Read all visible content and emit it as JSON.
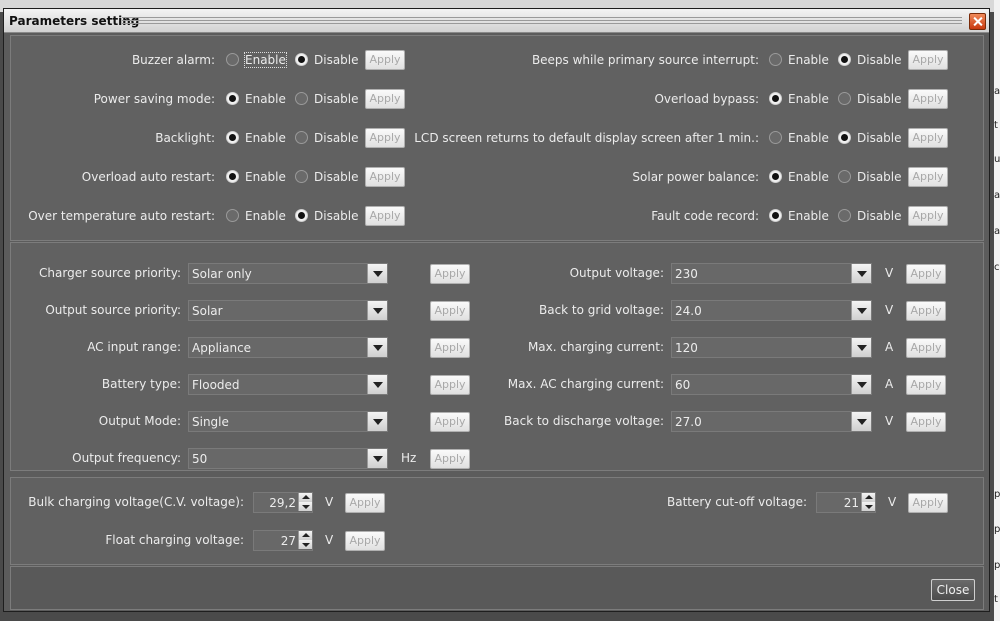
{
  "window": {
    "title": "Parameters setting",
    "close_label": "Close"
  },
  "common": {
    "enable": "Enable",
    "disable": "Disable",
    "apply": "Apply"
  },
  "toggles_left": [
    {
      "label": "Buzzer alarm:",
      "selected": "disable"
    },
    {
      "label": "Power saving mode:",
      "selected": "enable"
    },
    {
      "label": "Backlight:",
      "selected": "enable"
    },
    {
      "label": "Overload auto restart:",
      "selected": "enable"
    },
    {
      "label": "Over temperature auto restart:",
      "selected": "disable"
    }
  ],
  "toggles_right": [
    {
      "label": "Beeps while primary source interrupt:",
      "selected": "disable"
    },
    {
      "label": "Overload bypass:",
      "selected": "enable"
    },
    {
      "label": "LCD screen returns to default display screen after 1 min.:",
      "selected": "disable"
    },
    {
      "label": "Solar power balance:",
      "selected": "enable"
    },
    {
      "label": "Fault code record:",
      "selected": "enable"
    }
  ],
  "selects_left": [
    {
      "label": "Charger source priority:",
      "value": "Solar only",
      "unit": ""
    },
    {
      "label": "Output source priority:",
      "value": "Solar",
      "unit": ""
    },
    {
      "label": "AC input range:",
      "value": "Appliance",
      "unit": ""
    },
    {
      "label": "Battery type:",
      "value": "Flooded",
      "unit": ""
    },
    {
      "label": "Output Mode:",
      "value": "Single",
      "unit": ""
    },
    {
      "label": "Output frequency:",
      "value": "50",
      "unit": "Hz"
    }
  ],
  "selects_right": [
    {
      "label": "Output voltage:",
      "value": "230",
      "unit": "V"
    },
    {
      "label": "Back to grid voltage:",
      "value": "24.0",
      "unit": "V"
    },
    {
      "label": "Max. charging current:",
      "value": "120",
      "unit": "A"
    },
    {
      "label": "Max. AC charging current:",
      "value": "60",
      "unit": "A"
    },
    {
      "label": "Back to discharge voltage:",
      "value": "27.0",
      "unit": "V"
    }
  ],
  "spinners": [
    {
      "label": "Bulk charging voltage(C.V. voltage):",
      "value": "29,2",
      "unit": "V"
    },
    {
      "label": "Float charging voltage:",
      "value": "27",
      "unit": "V"
    },
    {
      "label": "Battery cut-off voltage:",
      "value": "21",
      "unit": "V"
    }
  ],
  "background_right_letters": [
    "a",
    "t",
    "u",
    "a",
    "a",
    "c",
    "p",
    "p",
    "p",
    "t"
  ]
}
